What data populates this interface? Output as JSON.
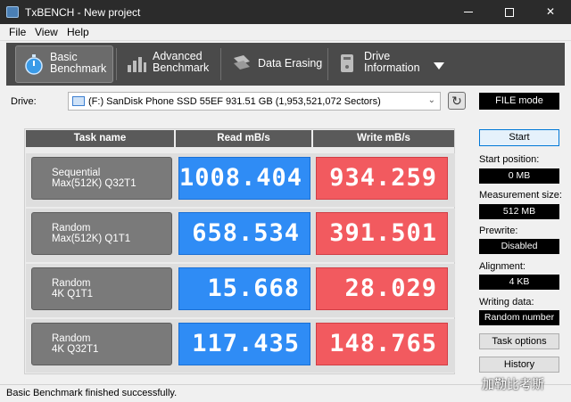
{
  "window": {
    "title": "TxBENCH - New project"
  },
  "menu": [
    "File",
    "View",
    "Help"
  ],
  "toolbar": {
    "tabs": [
      {
        "label": "Basic\nBenchmark",
        "icon": "stopwatch-icon"
      },
      {
        "label": "Advanced\nBenchmark",
        "icon": "bar-chart-icon"
      },
      {
        "label": "Data Erasing",
        "icon": "eraser-icon"
      },
      {
        "label": "Drive\nInformation",
        "icon": "drive-info-icon"
      }
    ]
  },
  "drive": {
    "label": "Drive:",
    "selected": "(F:) SanDisk Phone SSD 55EF  931.51 GB (1,953,521,072 Sectors)"
  },
  "mode": "FILE mode",
  "table": {
    "headers": [
      "Task name",
      "Read mB/s",
      "Write mB/s"
    ],
    "rows": [
      {
        "task": "Sequential\nMax(512K) Q32T1",
        "read": "1008.404",
        "write": "934.259"
      },
      {
        "task": "Random\nMax(512K) Q1T1",
        "read": "658.534",
        "write": "391.501"
      },
      {
        "task": "Random\n4K Q1T1",
        "read": "15.668",
        "write": "28.029"
      },
      {
        "task": "Random\n4K Q32T1",
        "read": "117.435",
        "write": "148.765"
      }
    ]
  },
  "side": {
    "start": "Start",
    "start_position_label": "Start position:",
    "start_position": "0 MB",
    "measurement_size_label": "Measurement size:",
    "measurement_size": "512 MB",
    "prewrite_label": "Prewrite:",
    "prewrite": "Disabled",
    "alignment_label": "Alignment:",
    "alignment": "4 KB",
    "writing_data_label": "Writing data:",
    "writing_data": "Random number",
    "task_options": "Task options",
    "history": "History"
  },
  "status": "Basic Benchmark finished successfully.",
  "watermark": "加勒比考斯"
}
